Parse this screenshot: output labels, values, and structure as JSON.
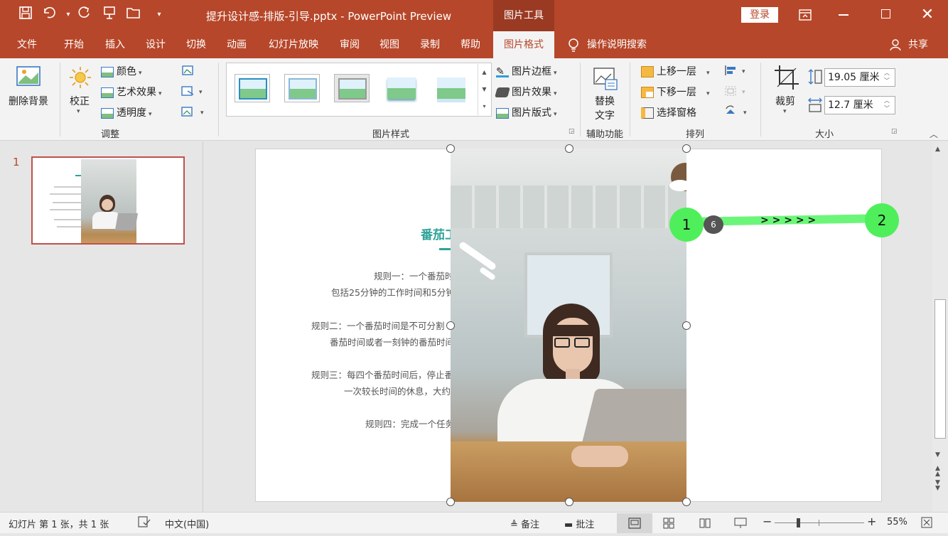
{
  "window": {
    "title": "提升设计感-排版-引导.pptx  -  PowerPoint Preview",
    "context_tab": "图片工具",
    "login": "登录",
    "share": "共享"
  },
  "tabs": [
    "文件",
    "开始",
    "插入",
    "设计",
    "切换",
    "动画",
    "幻灯片放映",
    "审阅",
    "视图",
    "录制",
    "帮助",
    "图片格式"
  ],
  "tell_me": "操作说明搜索",
  "ribbon": {
    "remove_bg": "删除背景",
    "corrections": "校正",
    "color": "颜色",
    "artistic": "艺术效果",
    "transparency": "透明度",
    "group_adjust": "调整",
    "group_styles": "图片样式",
    "border": "图片边框",
    "effects": "图片效果",
    "layout": "图片版式",
    "alt_text_1": "替换",
    "alt_text_2": "文字",
    "group_access": "辅助功能",
    "bring_forward": "上移一层",
    "send_backward": "下移一层",
    "selection_pane": "选择窗格",
    "group_arrange": "排列",
    "crop": "裁剪",
    "height": "19.05 厘米",
    "width": "12.7 厘米",
    "group_size": "大小"
  },
  "thumbnail": {
    "number": "1"
  },
  "slide": {
    "title": "番茄工",
    "rule1a": "规则一：一个番茄时",
    "rule1b": "包括25分钟的工作时间和5分钟",
    "rule2a": "规则二：一个番茄时间是不可分割",
    "rule2b": "番茄时间或者一刻钟的番茄时间",
    "rule3a": "规则三：每四个番茄时间后，停止番",
    "rule3b": "一次较长时间的休息，大约",
    "rule4": "规则四：完成一个任务"
  },
  "annotations": {
    "marker1": "1",
    "marker2": "2",
    "marker_count": "6",
    "arrows": "> > > > >"
  },
  "status": {
    "slide_info": "幻灯片 第 1 张，共 1 张",
    "language": "中文(中国)",
    "notes": "备注",
    "comments": "批注",
    "zoom": "55%"
  },
  "colors": {
    "accent": "#b7472a",
    "title_teal": "#2ea398",
    "marker_green": "#4fef5c"
  }
}
